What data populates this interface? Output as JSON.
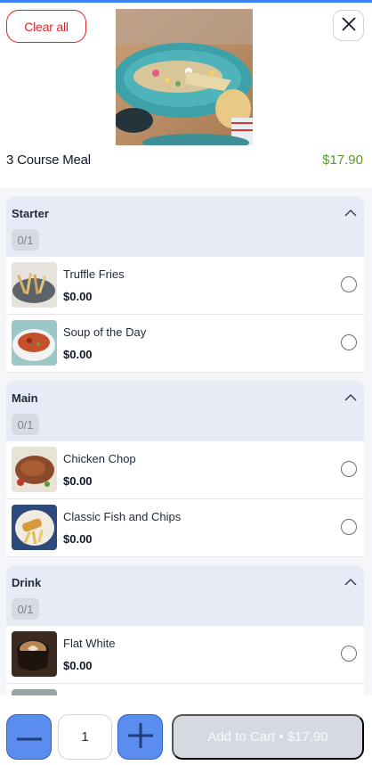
{
  "header": {
    "clear_all_label": "Clear all",
    "meal_title": "3 Course Meal",
    "meal_price": "$17.90",
    "close_icon": "close-icon",
    "hero_image": "salad-plate-image"
  },
  "groups": [
    {
      "title": "Starter",
      "count": "0/1",
      "items": [
        {
          "name": "Truffle Fries",
          "price": "$0.00",
          "image": "fries-image"
        },
        {
          "name": "Soup of the Day",
          "price": "$0.00",
          "image": "soup-image"
        }
      ]
    },
    {
      "title": "Main",
      "count": "0/1",
      "items": [
        {
          "name": "Chicken Chop",
          "price": "$0.00",
          "image": "chicken-image"
        },
        {
          "name": "Classic Fish and Chips",
          "price": "$0.00",
          "image": "fish-chips-image"
        }
      ]
    },
    {
      "title": "Drink",
      "count": "0/1",
      "items": [
        {
          "name": "Flat White",
          "price": "$0.00",
          "image": "coffee-image"
        }
      ]
    }
  ],
  "footer": {
    "quantity": "1",
    "add_to_cart_label": "Add to Cart • $17.90"
  },
  "colors": {
    "accent": "#5b8def",
    "danger": "#dc2626",
    "price_green": "#5a9a2b",
    "group_header_bg": "#e6ebf5"
  }
}
